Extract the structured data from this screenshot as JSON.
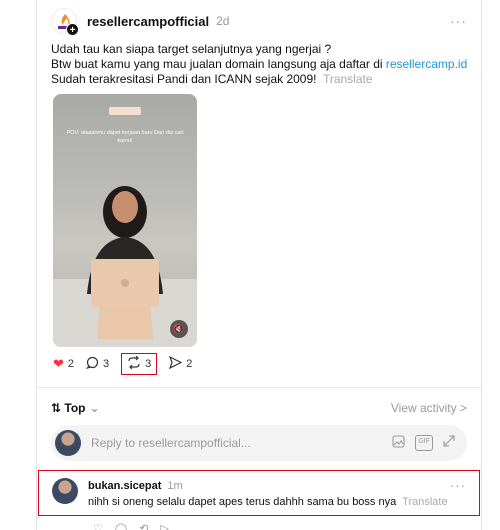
{
  "post": {
    "username": "resellercampofficial",
    "time": "2d",
    "more": "···",
    "text_line1": "Udah tau kan siapa target selanjutnya yang ngerjai ?",
    "text_line2_prefix": "Btw buat kamu yang mau jualan domain langsung aja daftar di ",
    "link": "resellercamp.id",
    "text_line3": "Sudah terakresitasi Pandi dan ICANN sejak 2009!",
    "translate": "Translate",
    "video_caption": "POV: atasanmu dapet kerjaan baru Dan dia cari kamu!"
  },
  "actions": {
    "likes": "2",
    "comments": "3",
    "reposts": "3",
    "shares": "2"
  },
  "sort": {
    "label": "Top",
    "view_activity": "View activity >"
  },
  "reply": {
    "placeholder": "Reply to resellercampofficial..."
  },
  "comment": {
    "username": "bukan.sicepat",
    "time": "1m",
    "more": "···",
    "text": "nihh si oneng selalu dapet apes terus dahhh sama bu boss nya",
    "translate": "Translate"
  },
  "colors": {
    "link": "#1e9ad6",
    "heart": "#ff3040",
    "highlight": "#e0001b"
  }
}
